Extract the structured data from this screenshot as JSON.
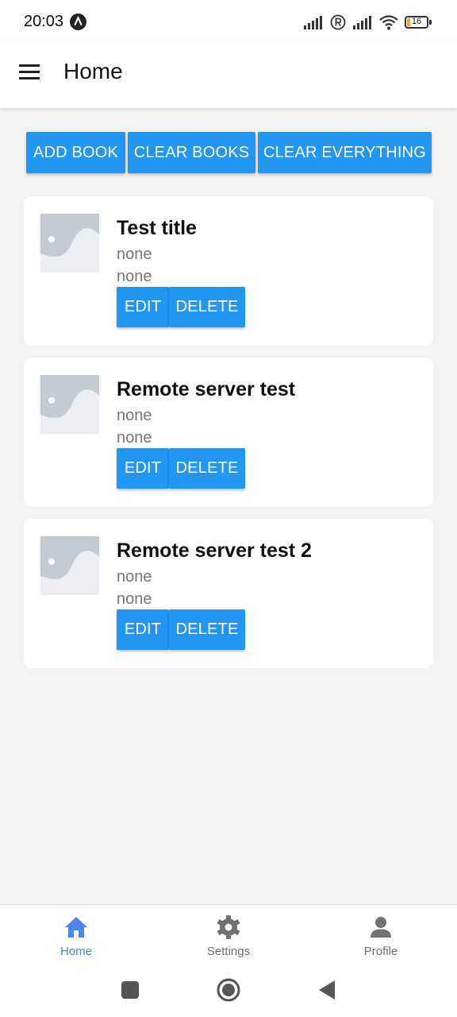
{
  "status_bar": {
    "time": "20:03",
    "battery_level": "16"
  },
  "header": {
    "title": "Home"
  },
  "toolbar": {
    "add_book": "ADD BOOK",
    "clear_books": "CLEAR BOOKS",
    "clear_everything": "CLEAR EVERYTHING"
  },
  "books": [
    {
      "title": "Test title",
      "line1": "none",
      "line2": "none",
      "edit": "EDIT",
      "delete": "DELETE"
    },
    {
      "title": "Remote server test",
      "line1": "none",
      "line2": "none",
      "edit": "EDIT",
      "delete": "DELETE"
    },
    {
      "title": "Remote server test 2",
      "line1": "none",
      "line2": "none",
      "edit": "EDIT",
      "delete": "DELETE"
    }
  ],
  "bottom_nav": {
    "items": [
      {
        "label": "Home",
        "icon": "home-icon",
        "active": true
      },
      {
        "label": "Settings",
        "icon": "gear-icon",
        "active": false
      },
      {
        "label": "Profile",
        "icon": "person-icon",
        "active": false
      }
    ]
  },
  "colors": {
    "primary": "#2196f3",
    "active_nav": "#4a86e8",
    "inactive_nav": "#707070",
    "background": "#f3f3f3"
  }
}
